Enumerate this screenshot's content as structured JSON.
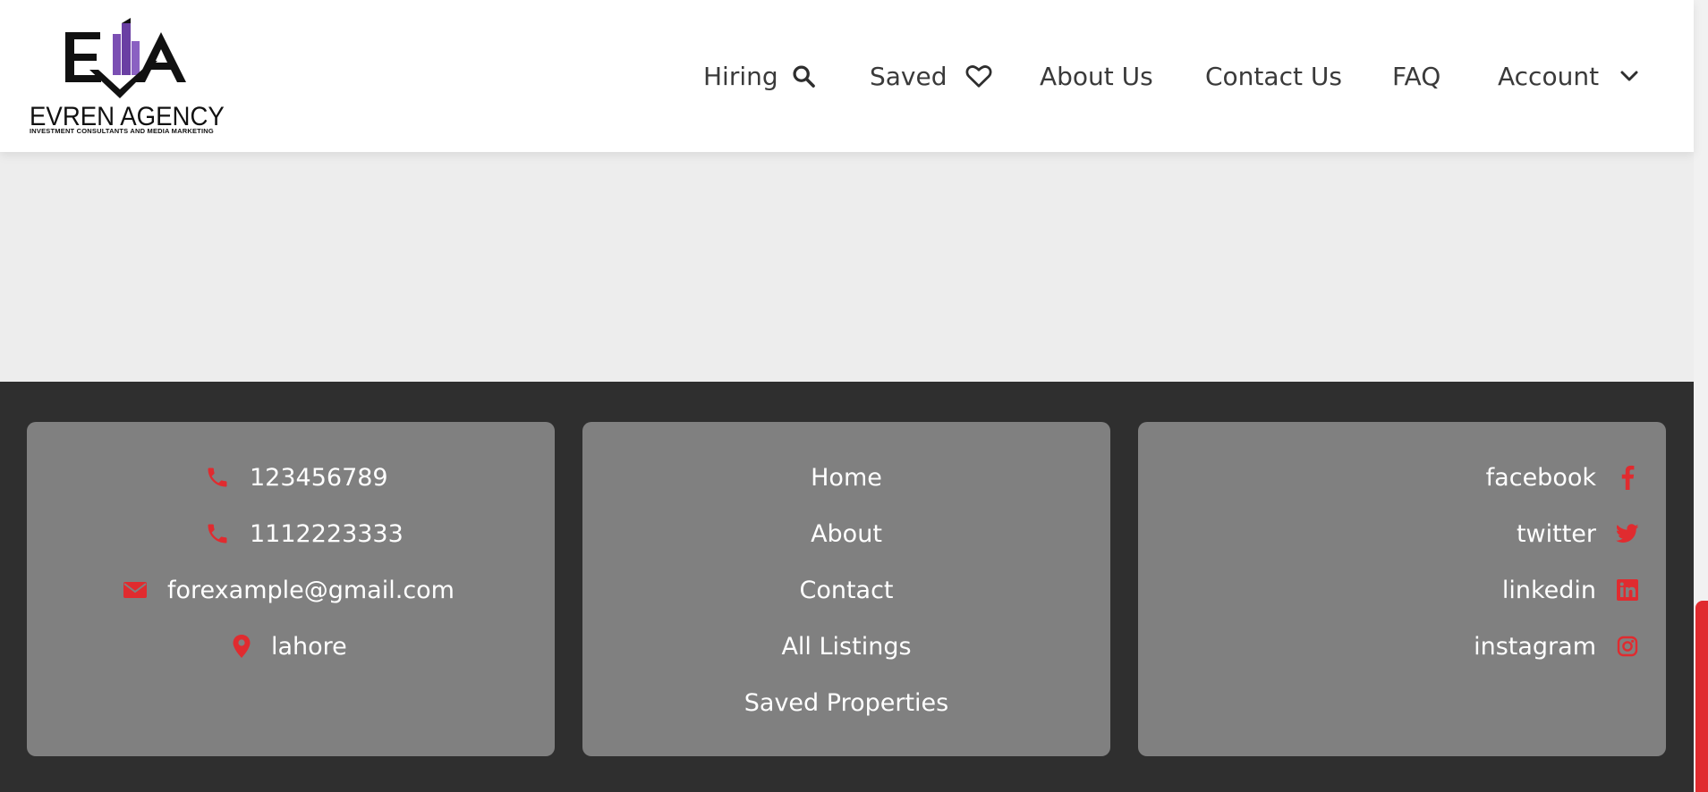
{
  "brand": {
    "name": "EVREN AGENCY",
    "tagline": "INVESTMENT CONSULTANTS AND MEDIA MARKETING",
    "monogram": "EA"
  },
  "nav": {
    "items": [
      {
        "label": "Hiring",
        "icon": "search-icon"
      },
      {
        "label": "Saved",
        "icon": "heart-icon"
      },
      {
        "label": "About Us"
      },
      {
        "label": "Contact Us"
      },
      {
        "label": "FAQ"
      },
      {
        "label": "Account",
        "icon": "chevron-down-icon"
      }
    ]
  },
  "footer": {
    "contact": [
      {
        "icon": "phone-icon",
        "text": "123456789"
      },
      {
        "icon": "phone-icon",
        "text": "1112223333"
      },
      {
        "icon": "envelope-icon",
        "text": "forexample@gmail.com"
      },
      {
        "icon": "map-pin-icon",
        "text": "lahore"
      }
    ],
    "links": [
      "Home",
      "About",
      "Contact",
      "All Listings",
      "Saved Properties"
    ],
    "social": [
      {
        "label": "facebook",
        "icon": "facebook-icon"
      },
      {
        "label": "twitter",
        "icon": "twitter-icon"
      },
      {
        "label": "linkedin",
        "icon": "linkedin-icon"
      },
      {
        "label": "instagram",
        "icon": "instagram-icon"
      }
    ]
  },
  "colors": {
    "accent": "#e02b2f",
    "footer_bg": "#2f2f2f",
    "card_bg": "#808080",
    "page_bg": "#ededed",
    "logo_purple": "#7b4fb3"
  }
}
